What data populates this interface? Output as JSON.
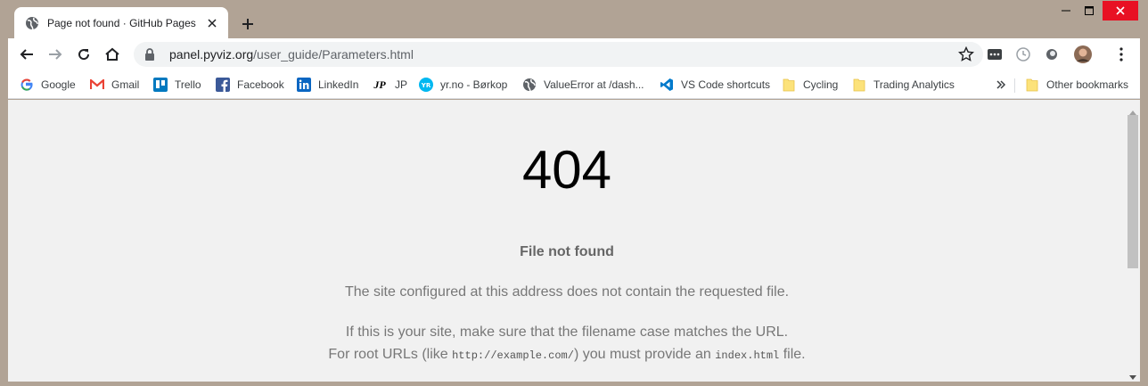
{
  "window": {
    "tab_title": "Page not found · GitHub Pages",
    "frame_color": "#b1a395",
    "close_color": "#e81123"
  },
  "toolbar": {
    "url_host": "panel.pyviz.org",
    "url_path": "/user_guide/Parameters.html"
  },
  "bookmarks": [
    {
      "label": "Google",
      "icon": "google-icon"
    },
    {
      "label": "Gmail",
      "icon": "gmail-icon"
    },
    {
      "label": "Trello",
      "icon": "trello-icon"
    },
    {
      "label": "Facebook",
      "icon": "facebook-icon"
    },
    {
      "label": "LinkedIn",
      "icon": "linkedin-icon"
    },
    {
      "label": "JP",
      "icon": "jp-icon"
    },
    {
      "label": "yr.no - Børkop",
      "icon": "yr-icon"
    },
    {
      "label": "ValueError at /dash...",
      "icon": "globe-icon"
    },
    {
      "label": "VS Code shortcuts",
      "icon": "vscode-icon"
    },
    {
      "label": "Cycling",
      "icon": "folder-icon"
    },
    {
      "label": "Trading Analytics",
      "icon": "folder-icon"
    },
    {
      "label": "Other bookmarks",
      "icon": "folder-icon"
    }
  ],
  "page": {
    "code": "404",
    "title": "File not found",
    "p1": "The site configured at this address does not contain the requested file.",
    "p2_line1": "If this is your site, make sure that the filename case matches the URL.",
    "p2_a": "For root URLs (like ",
    "p2_code1": "http://example.com/",
    "p2_b": ") you must provide an ",
    "p2_code2": "index.html",
    "p2_c": " file."
  }
}
